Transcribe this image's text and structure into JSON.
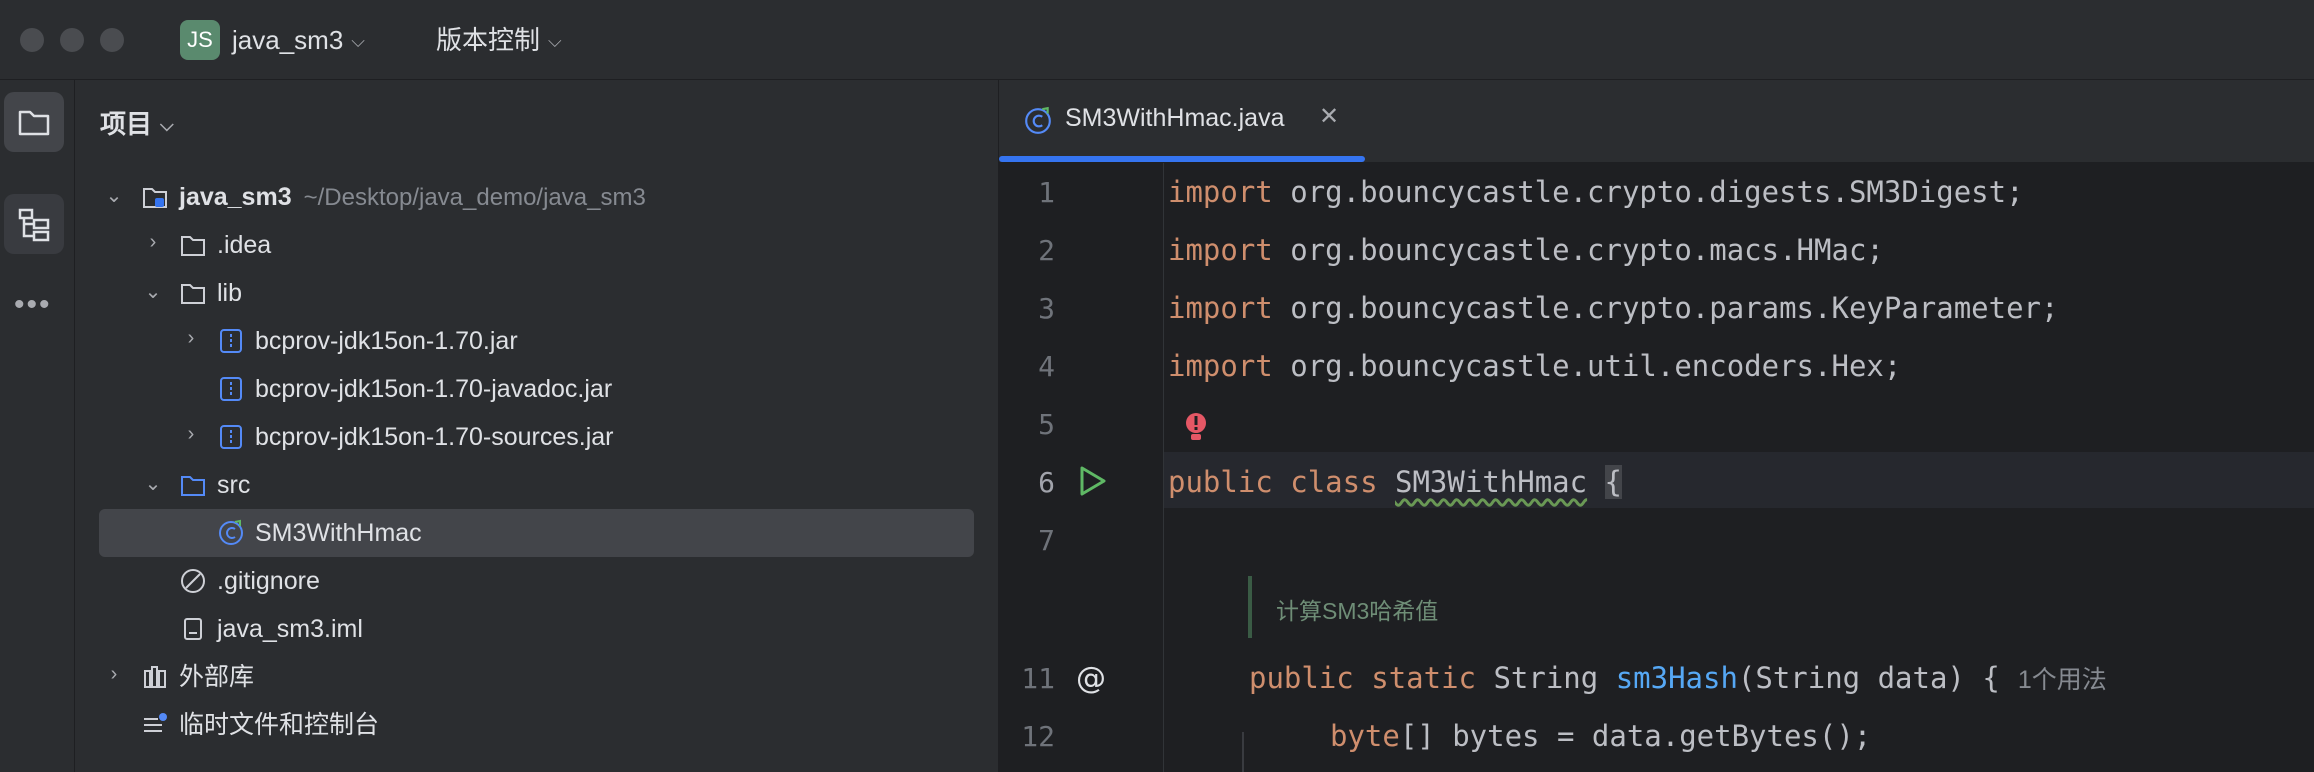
{
  "titlebar": {
    "project_badge": "JS",
    "project_name": "java_sm3",
    "vcs_label": "版本控制"
  },
  "panel": {
    "title": "项目"
  },
  "tree": {
    "root": {
      "label": "java_sm3",
      "path": "~/Desktop/java_demo/java_sm3"
    },
    "idea": ".idea",
    "lib": "lib",
    "jar1": "bcprov-jdk15on-1.70.jar",
    "jar2": "bcprov-jdk15on-1.70-javadoc.jar",
    "jar3": "bcprov-jdk15on-1.70-sources.jar",
    "src": "src",
    "file_main": "SM3WithHmac",
    "gitignore": ".gitignore",
    "iml": "java_sm3.iml",
    "external_libs": "外部库",
    "scratches": "临时文件和控制台"
  },
  "editor": {
    "tab_label": "SM3WithHmac.java",
    "line_numbers": [
      "1",
      "2",
      "3",
      "4",
      "5",
      "6",
      "7",
      "11",
      "12"
    ],
    "imports": [
      "org.bouncycastle.crypto.digests.SM3Digest;",
      "org.bouncycastle.crypto.macs.HMac;",
      "org.bouncycastle.crypto.params.KeyParameter;",
      "org.bouncycastle.util.encoders.Hex;"
    ],
    "kw_import": "import",
    "kw_public": "public",
    "kw_class": "class",
    "kw_static": "static",
    "class_name": "SM3WithHmac",
    "open_brace": "{",
    "doc_comment": "计算SM3哈希值",
    "method_type": "String",
    "method_name": "sm3Hash",
    "method_params": "(String data) {",
    "usage_hint": "1个用法",
    "kw_byte": "byte",
    "line12_rest": "[] bytes = data.getBytes();"
  },
  "colors": {
    "accent": "#3574f0",
    "keyword": "#cf8e6d",
    "function": "#56a8f5",
    "run_icon": "#5fb865"
  },
  "icons": [
    "folder-icon",
    "structure-icon",
    "more-icon",
    "java-class-icon",
    "close-icon",
    "run-icon",
    "at-override-icon",
    "bulb-error-icon",
    "jar-icon",
    "library-icon",
    "scratches-icon",
    "gitignore-icon",
    "iml-file-icon"
  ]
}
